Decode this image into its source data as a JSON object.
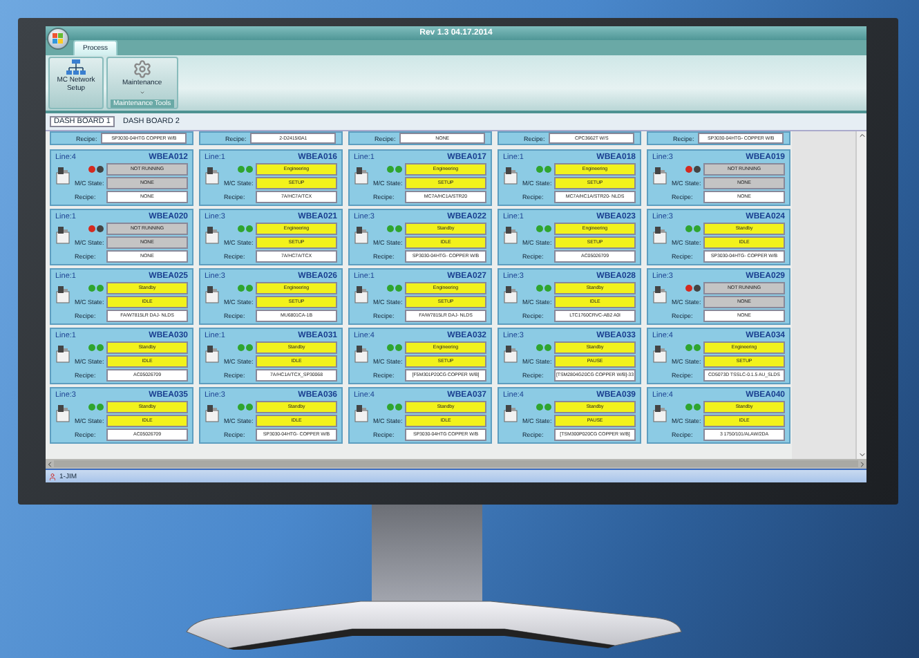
{
  "window": {
    "title": "Rev 1.3  04.17.2014"
  },
  "ribbon_tabs": [
    {
      "label": "Process",
      "selected": true
    }
  ],
  "ribbon_groups": [
    {
      "buttons": [
        {
          "kind": "network",
          "label": "MC Network Setup"
        }
      ]
    },
    {
      "label": "Maintenance Tools",
      "buttons": [
        {
          "kind": "gear",
          "label": "Maintenance",
          "dropdown": true
        }
      ]
    }
  ],
  "dashboard_tabs": [
    {
      "label": "DASH BOARD 1",
      "selected": true
    },
    {
      "label": "DASH BOARD 2",
      "selected": false
    }
  ],
  "partial_row": [
    {
      "recipe_label": "Recipe:",
      "recipe": "SP3030-04HTG COPPER W/B"
    },
    {
      "recipe_label": "Recipe:",
      "recipe": "2-D2415I0A1"
    },
    {
      "recipe_label": "Recipe:",
      "recipe": "NONE"
    },
    {
      "recipe_label": "Recipe:",
      "recipe": "CPC3662T W/S"
    },
    {
      "recipe_label": "Recipe:",
      "recipe": "SP3030-04HTG- COPPER W/B"
    }
  ],
  "cards": [
    {
      "line": "Line:4",
      "id": "WBEA012",
      "running": false,
      "status": "NOT RUNNING",
      "state_label": "M/C State:",
      "state": "NONE",
      "recipe_label": "Recipe:",
      "recipe": "NONE"
    },
    {
      "line": "Line:1",
      "id": "WBEA016",
      "running": true,
      "status": "Engineering",
      "state_label": "M/C State:",
      "state": "SETUP",
      "recipe_label": "Recipe:",
      "recipe": "7A/HC7A/TCX"
    },
    {
      "line": "Line:1",
      "id": "WBEA017",
      "running": true,
      "status": "Engineering",
      "state_label": "M/C State:",
      "state": "SETUP",
      "recipe_label": "Recipe:",
      "recipe": "MC7A/HC1A/STR20"
    },
    {
      "line": "Line:1",
      "id": "WBEA018",
      "running": true,
      "status": "Engineering",
      "state_label": "M/C State:",
      "state": "SETUP",
      "recipe_label": "Recipe:",
      "recipe": "MC7A/HC1A/STR20- NLDS"
    },
    {
      "line": "Line:3",
      "id": "WBEA019",
      "running": false,
      "status": "NOT RUNNING",
      "state_label": "M/C State:",
      "state": "NONE",
      "recipe_label": "Recipe:",
      "recipe": "NONE"
    },
    {
      "line": "Line:1",
      "id": "WBEA020",
      "running": false,
      "status": "NOT RUNNING",
      "state_label": "M/C State:",
      "state": "NONE",
      "recipe_label": "Recipe:",
      "recipe": "NONE"
    },
    {
      "line": "Line:3",
      "id": "WBEA021",
      "running": true,
      "status": "Engineering",
      "state_label": "M/C State:",
      "state": "SETUP",
      "recipe_label": "Recipe:",
      "recipe": "7A/HC7A/TCX"
    },
    {
      "line": "Line:3",
      "id": "WBEA022",
      "running": true,
      "status": "Standby",
      "state_label": "M/C State:",
      "state": "IDLE",
      "recipe_label": "Recipe:",
      "recipe": "SP3030-04HTG- COPPER W/B"
    },
    {
      "line": "Line:1",
      "id": "WBEA023",
      "running": true,
      "status": "Engineering",
      "state_label": "M/C State:",
      "state": "SETUP",
      "recipe_label": "Recipe:",
      "recipe": "AC05026709"
    },
    {
      "line": "Line:3",
      "id": "WBEA024",
      "running": true,
      "status": "Standby",
      "state_label": "M/C State:",
      "state": "IDLE",
      "recipe_label": "Recipe:",
      "recipe": "SP3030-04HTG- COPPER W/B"
    },
    {
      "line": "Line:1",
      "id": "WBEA025",
      "running": true,
      "status": "Standby",
      "state_label": "M/C State:",
      "state": "IDLE",
      "recipe_label": "Recipe:",
      "recipe": "FA/W7815LR DAJ- NLDS"
    },
    {
      "line": "Line:3",
      "id": "WBEA026",
      "running": true,
      "status": "Engineering",
      "state_label": "M/C State:",
      "state": "SETUP",
      "recipe_label": "Recipe:",
      "recipe": "MU6801CA-1B"
    },
    {
      "line": "Line:1",
      "id": "WBEA027",
      "running": true,
      "status": "Engineering",
      "state_label": "M/C State:",
      "state": "SETUP",
      "recipe_label": "Recipe:",
      "recipe": "FA/W7815LR DAJ- NLDS"
    },
    {
      "line": "Line:3",
      "id": "WBEA028",
      "running": true,
      "status": "Standby",
      "state_label": "M/C State:",
      "state": "IDLE",
      "recipe_label": "Recipe:",
      "recipe": "LTC1760CRVC-AB2 A0I"
    },
    {
      "line": "Line:3",
      "id": "WBEA029",
      "running": false,
      "status": "NOT RUNNING",
      "state_label": "M/C State:",
      "state": "NONE",
      "recipe_label": "Recipe:",
      "recipe": "NONE"
    },
    {
      "line": "Line:1",
      "id": "WBEA030",
      "running": true,
      "status": "Standby",
      "state_label": "M/C State:",
      "state": "IDLE",
      "recipe_label": "Recipe:",
      "recipe": "AC05026709"
    },
    {
      "line": "Line:1",
      "id": "WBEA031",
      "running": true,
      "status": "Standby",
      "state_label": "M/C State:",
      "state": "IDLE",
      "recipe_label": "Recipe:",
      "recipe": "7A/HC1A/TCX_SP30068"
    },
    {
      "line": "Line:4",
      "id": "WBEA032",
      "running": true,
      "status": "Engineering",
      "state_label": "M/C State:",
      "state": "SETUP",
      "recipe_label": "Recipe:",
      "recipe": "[F5M301P20CG COPPER W/B]"
    },
    {
      "line": "Line:3",
      "id": "WBEA033",
      "running": true,
      "status": "Standby",
      "state_label": "M/C State:",
      "state": "PAUSE",
      "recipe_label": "Recipe:",
      "recipe": "[TSM2804G20CG COPPER W/B]-33"
    },
    {
      "line": "Line:4",
      "id": "WBEA034",
      "running": true,
      "status": "Engineering",
      "state_label": "M/C State:",
      "state": "SETUP",
      "recipe_label": "Recipe:",
      "recipe": "CD5073D TSSLC-0.1.5 AU_SLDS"
    },
    {
      "line": "Line:3",
      "id": "WBEA035",
      "running": true,
      "status": "Standby",
      "state_label": "M/C State:",
      "state": "IDLE",
      "recipe_label": "Recipe:",
      "recipe": "AC05026709"
    },
    {
      "line": "Line:3",
      "id": "WBEA036",
      "running": true,
      "status": "Standby",
      "state_label": "M/C State:",
      "state": "IDLE",
      "recipe_label": "Recipe:",
      "recipe": "SP3030-04HTG- COPPER W/B"
    },
    {
      "line": "Line:4",
      "id": "WBEA037",
      "running": true,
      "status": "Standby",
      "state_label": "M/C State:",
      "state": "IDLE",
      "recipe_label": "Recipe:",
      "recipe": "SP3030-04HTG COPPER W/B"
    },
    {
      "line": "Line:4",
      "id": "WBEA039",
      "running": true,
      "status": "Standby",
      "state_label": "M/C State:",
      "state": "PAUSE",
      "recipe_label": "Recipe:",
      "recipe": "[TSM300P020CG COPPER W/B]"
    },
    {
      "line": "Line:4",
      "id": "WBEA040",
      "running": true,
      "status": "Standby",
      "state_label": "M/C State:",
      "state": "IDLE",
      "recipe_label": "Recipe:",
      "recipe": "3 1750/101/ALAW/2DA"
    }
  ],
  "status_bar": {
    "user": "1-JIM"
  }
}
